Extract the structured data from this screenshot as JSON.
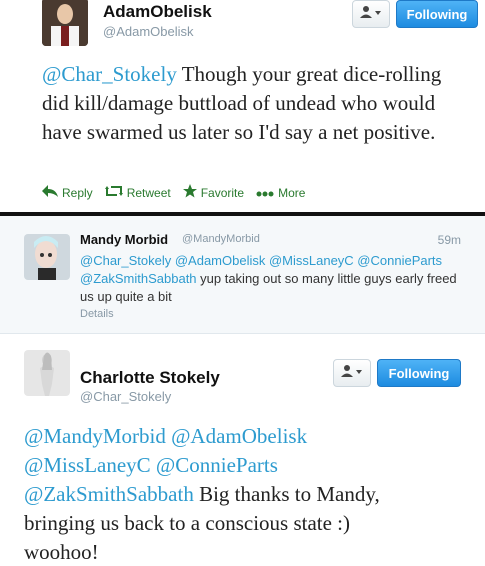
{
  "tweet1": {
    "name": "AdamObelisk",
    "handle": "@AdamObelisk",
    "follow_label": "Following",
    "mention": "@Char_Stokely",
    "text": " Though your great dice-rolling did kill/damage buttload of undead who would have swarmed us later so I'd say a net positive.",
    "actions": {
      "reply": "Reply",
      "retweet": "Retweet",
      "favorite": "Favorite",
      "more": "More"
    }
  },
  "tweet2": {
    "name": "Mandy Morbid",
    "handle": "@MandyMorbid",
    "time": "59m",
    "mentions": "@Char_Stokely @AdamObelisk @MissLaneyC @ConnieParts @ZakSmithSabbath",
    "text": " yup taking out so many little guys early freed us up quite a bit",
    "details": "Details"
  },
  "tweet3": {
    "name": "Charlotte Stokely",
    "handle": "@Char_Stokely",
    "follow_label": "Following",
    "mention_line1": "@MandyMorbid @AdamObelisk",
    "mention_line2": "@MissLaneyC @ConnieParts",
    "mention_line3": "@ZakSmithSabbath",
    "text_line3": " Big thanks to Mandy,",
    "text_line4": "bringing us back to a conscious state :)",
    "text_line5": "woohoo!"
  },
  "colors": {
    "mention": "#2d9bcf",
    "action_green": "#2a7a2f",
    "follow_blue": "#1d8be0"
  }
}
